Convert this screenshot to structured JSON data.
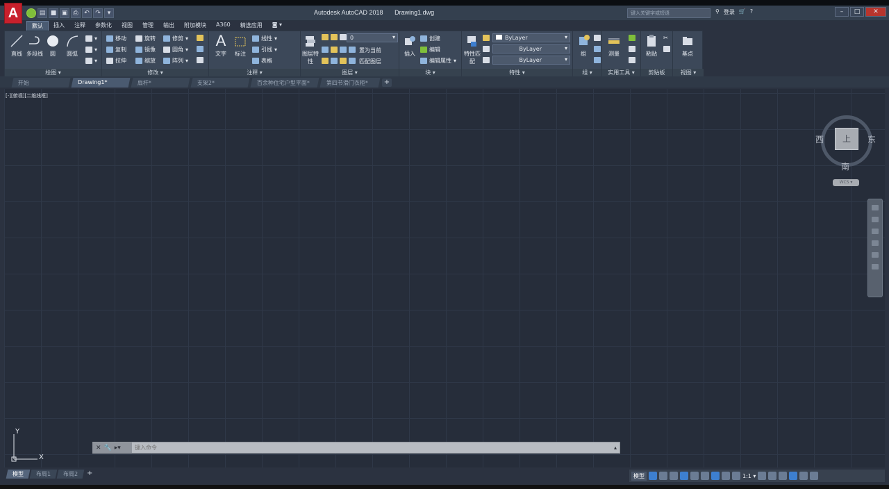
{
  "window": {
    "title": "Autodesk AutoCAD 2018",
    "document": "Drawing1.dwg",
    "search_placeholder": "键入关键字或短语",
    "login": "登录"
  },
  "ribbon_tabs": [
    {
      "label": "默认",
      "active": true
    },
    {
      "label": "插入"
    },
    {
      "label": "注释"
    },
    {
      "label": "参数化"
    },
    {
      "label": "视图"
    },
    {
      "label": "管理"
    },
    {
      "label": "输出"
    },
    {
      "label": "附加模块"
    },
    {
      "label": "A360"
    },
    {
      "label": "精选应用"
    }
  ],
  "panels": {
    "draw": {
      "label": "绘图 ▾",
      "line": "直线",
      "polyline": "多段线",
      "circle": "圆",
      "arc": "圆弧"
    },
    "modify": {
      "label": "修改 ▾",
      "move": "移动",
      "rotate": "旋转",
      "trim": "修剪",
      "copy": "复制",
      "mirror": "镜像",
      "fillet": "圆角",
      "stretch": "拉伸",
      "scale": "缩放",
      "array": "阵列"
    },
    "annotation": {
      "label": "注释 ▾",
      "text": "文字",
      "dimension": "标注",
      "linear": "线性",
      "leader": "引线",
      "table": "表格"
    },
    "layers": {
      "label": "图层 ▾",
      "layer_props": "图层特性",
      "current_layer": "0",
      "set_current": "置为当前",
      "match_layer": "匹配图层"
    },
    "block": {
      "label": "块 ▾",
      "insert": "插入",
      "create": "创建",
      "edit": "编辑",
      "edit_attr": "编辑属性"
    },
    "properties": {
      "label": "特性 ▾",
      "match": "特性匹配",
      "color": "ByLayer",
      "linetype": "ByLayer",
      "lineweight": "ByLayer"
    },
    "groups": {
      "label": "组 ▾",
      "group": "组"
    },
    "utilities": {
      "label": "实用工具 ▾",
      "measure": "测量"
    },
    "clipboard": {
      "label": "剪贴板",
      "paste": "粘贴"
    },
    "view": {
      "label": "视图 ▾",
      "base": "基点"
    }
  },
  "file_tabs": [
    {
      "label": "开始"
    },
    {
      "label": "Drawing1*",
      "active": true
    },
    {
      "label": "扇杆*"
    },
    {
      "label": "支架2*"
    },
    {
      "label": "百余种住宅户型平面*"
    },
    {
      "label": "第四节滑门衣柜*"
    }
  ],
  "viewport_label": "[-][俯视][二维线框]",
  "viewcube": {
    "west": "西",
    "east": "东",
    "south": "南",
    "face": "上",
    "wcs": "WCS ▾"
  },
  "ucs": {
    "x": "X",
    "y": "Y"
  },
  "command": {
    "placeholder": "键入命令"
  },
  "layout_tabs": [
    {
      "label": "模型",
      "active": true
    },
    {
      "label": "布局1"
    },
    {
      "label": "布局2"
    }
  ],
  "status": {
    "model": "模型",
    "scale": "1:1 ▾"
  }
}
